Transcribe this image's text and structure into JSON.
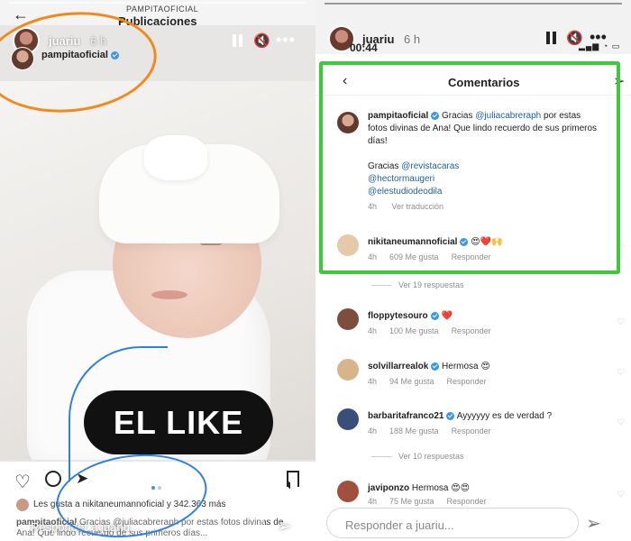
{
  "left": {
    "small_handle": "PAMPITAOFICIAL",
    "header_title": "Publicaciones",
    "story_user": "juariu",
    "story_time": "6 h",
    "post_user": "pampitaoficial",
    "overlay_text": "EL LIKE",
    "liked_by": "Les gusta a nikitaneumannoficial y 342.363 más",
    "caption_user": "pampitaoficial",
    "caption_text": "Gracias @juliacabreraph por estas fotos divinas de Ana! Que lindo recuerdo de sus primeros días...",
    "reply_placeholder": "Responder a juariu..."
  },
  "right": {
    "story_user": "juariu",
    "story_time": "6 h",
    "clock": "00:44",
    "panel_title": "Comentarios",
    "main_comment": {
      "user": "pampitaoficial",
      "text_a": "Gracias ",
      "mention_1": "@juliacabreraph",
      "text_b": " por estas fotos divinas de Ana! Que lindo recuerdo de sus primeros días!",
      "thanks": "Gracias ",
      "mention_2": "@revistacaras",
      "mention_3": "@hectormaugeri",
      "mention_4": "@elestudiodeodila",
      "time": "4h",
      "action": "Ver traducción"
    },
    "comments": [
      {
        "user": "nikitaneumannoficial",
        "text": "😍❤️🙌",
        "time": "4h",
        "likes": "609 Me gusta",
        "reply": "Responder"
      },
      {
        "user": "floppytesouro",
        "text": "❤️",
        "time": "4h",
        "likes": "100 Me gusta",
        "reply": "Responder"
      },
      {
        "user": "solvillarrealok",
        "text": "Hermosa 😍",
        "time": "4h",
        "likes": "94 Me gusta",
        "reply": "Responder"
      },
      {
        "user": "barbaritafranco21",
        "text": "Ayyyyyy es de verdad ?",
        "time": "4h",
        "likes": "188 Me gusta",
        "reply": "Responder"
      },
      {
        "user": "javiponzo",
        "text": "Hermosa 😍😍",
        "time": "4h",
        "likes": "75 Me gusta",
        "reply": "Responder"
      }
    ],
    "see_replies_1": "Ver 19 respuestas",
    "see_replies_2": "Ver 10 respuestas",
    "reply_placeholder": "Responder a juariu..."
  },
  "colors": {
    "annotation_orange": "#f28a1b",
    "annotation_blue": "#2f7fe0",
    "annotation_green": "#3ec93a",
    "verified_blue": "#3897f0"
  }
}
